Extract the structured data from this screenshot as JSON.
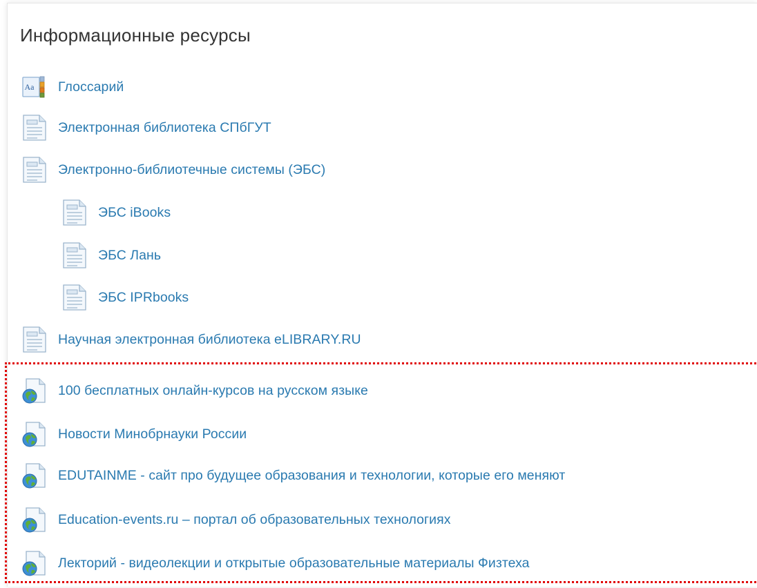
{
  "block": {
    "title": "Информационные ресурсы",
    "items": [
      {
        "label": "Глоссарий",
        "icon": "glossary-icon"
      },
      {
        "label": "Электронная библиотека СПбГУТ",
        "icon": "page-icon"
      },
      {
        "label": "Электронно-библиотечные системы (ЭБС)",
        "icon": "page-icon"
      },
      {
        "label": "ЭБС iBooks",
        "icon": "page-icon"
      },
      {
        "label": "ЭБС Лань",
        "icon": "page-icon"
      },
      {
        "label": "ЭБС IPRbooks",
        "icon": "page-icon"
      },
      {
        "label": "Научная электронная библиотека eLIBRARY.RU",
        "icon": "page-icon"
      },
      {
        "label": "100 бесплатных онлайн-курсов на русском языке",
        "icon": "url-globe-icon"
      },
      {
        "label": "Новости Минобрнауки России",
        "icon": "url-globe-icon"
      },
      {
        "label": "EDUTAINME - сайт про будущее образования и технологии, которые его меняют",
        "icon": "url-globe-icon"
      },
      {
        "label": "Education-events.ru – портал об образовательных технологиях",
        "icon": "url-globe-icon"
      },
      {
        "label": "Лекторий - видеолекции и открытые образовательные материалы Физтеха",
        "icon": "url-globe-icon"
      }
    ]
  },
  "colors": {
    "link": "#2a7ab0",
    "title": "#333333",
    "highlight_border": "#e00000"
  }
}
